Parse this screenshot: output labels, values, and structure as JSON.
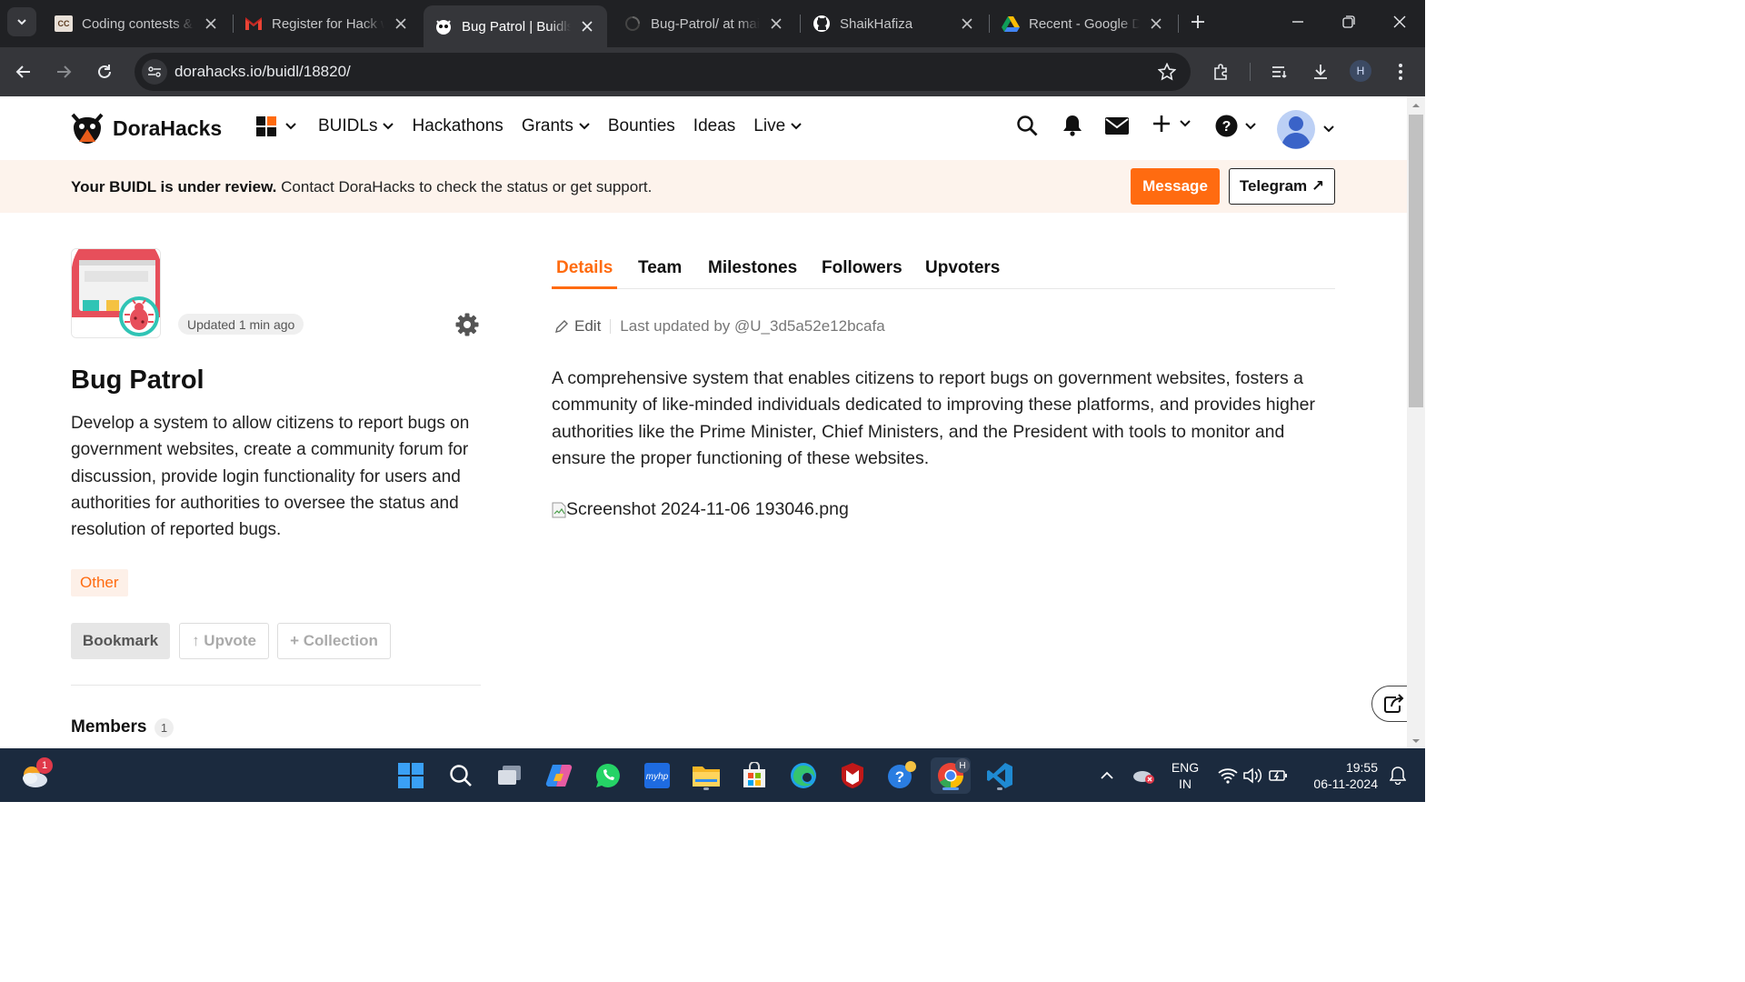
{
  "browser": {
    "tabs": [
      {
        "title": "Coding contests & ",
        "active": false
      },
      {
        "title": "Register for Hack w",
        "active": false
      },
      {
        "title": "Bug Patrol | Buidls",
        "active": true
      },
      {
        "title": "Bug-Patrol/ at main",
        "active": false
      },
      {
        "title": "ShaikHafiza",
        "active": false
      },
      {
        "title": "Recent - Google Dr",
        "active": false
      }
    ],
    "url": "dorahacks.io/buidl/18820/",
    "profile_initial": "H",
    "favicon_cc": "CC"
  },
  "site": {
    "brand": "DoraHacks",
    "nav": {
      "buidls": "BUIDLs",
      "hackathons": "Hackathons",
      "grants": "Grants",
      "bounties": "Bounties",
      "ideas": "Ideas",
      "live": "Live"
    }
  },
  "banner": {
    "bold": "Your BUIDL is under review.",
    "text": " Contact DoraHacks to check the status or get support.",
    "message_button": "Message",
    "telegram_button": "Telegram ↗"
  },
  "project": {
    "updated": "Updated 1 min ago",
    "title": "Bug Patrol",
    "description": "Develop a system to allow citizens to report bugs on government websites, create a community forum for discussion, provide login functionality for users and authorities for authorities to oversee the status and resolution of reported bugs.",
    "tag": "Other",
    "bookmark": "Bookmark",
    "upvote": "↑ Upvote",
    "collection": "+ Collection",
    "members_label": "Members",
    "members_count": "1"
  },
  "details": {
    "tabs": [
      "Details",
      "Team",
      "Milestones",
      "Followers",
      "Upvoters"
    ],
    "active_tab": "Details",
    "edit_label": "Edit",
    "last_updated": "Last updated by @U_3d5a52e12bcafa",
    "body": "A comprehensive system that enables citizens to report bugs on government websites, fosters a community of like-minded individuals dedicated to improving these platforms, and provides higher authorities like the Prime Minister, Chief Ministers, and the President with tools to monitor and ensure the proper functioning of these websites.",
    "image_alt": "Screenshot 2024-11-06 193046.png"
  },
  "taskbar": {
    "notification_badge": "1",
    "language": "ENG",
    "region": "IN",
    "time": "19:55",
    "date": "06-11-2024",
    "chrome_badge": "H"
  },
  "colors": {
    "accent": "#ff6b10",
    "banner_bg": "#fdf3ec",
    "browser_dark": "#202124",
    "taskbar": "#1b2a3e"
  }
}
